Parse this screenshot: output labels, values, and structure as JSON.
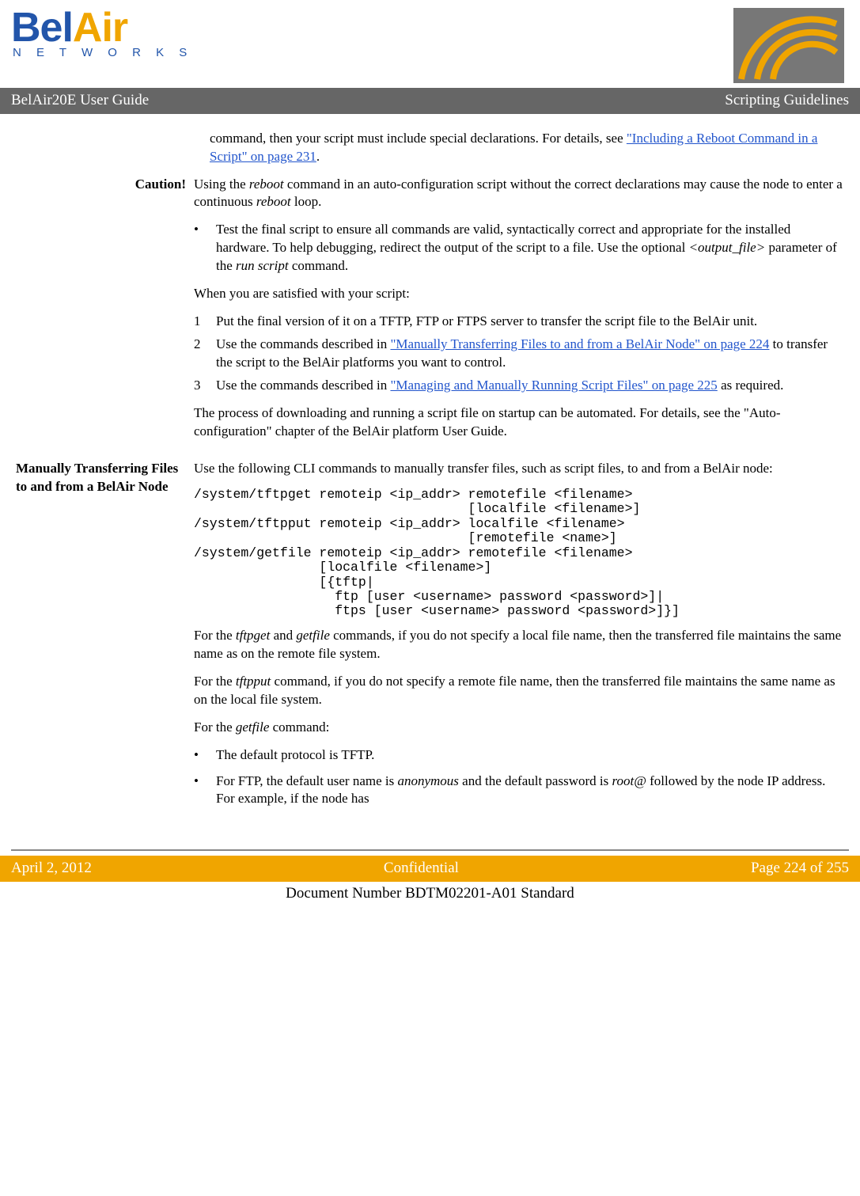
{
  "logo": {
    "brand": "BelAir",
    "sub": "N E T W O R K S"
  },
  "titlebar": {
    "left": "BelAir20E User Guide",
    "right": "Scripting Guidelines"
  },
  "intro": {
    "pre": "command, then your script must include special declarations. For details, see ",
    "link": "\"Including a Reboot Command in a Script\" on page 231",
    "post": "."
  },
  "caution": {
    "label": "Caution!",
    "p1a": "Using the ",
    "p1b": "reboot",
    "p1c": " command in an auto-configuration script without the correct declarations may cause the node to enter a continuous ",
    "p1d": "reboot",
    "p1e": " loop."
  },
  "test_bullet": {
    "a": "Test the final script to ensure all commands are valid, syntactically correct and appropriate for the installed hardware. To help debugging, redirect the output of the script to a file. Use the optional ",
    "b": "<output_file>",
    "c": " parameter of the ",
    "d": "run script",
    "e": " command."
  },
  "satisfied": "When you are satisfied with your script:",
  "steps": {
    "s1": "Put the final version of it on a TFTP, FTP or FTPS server to transfer the script file to the BelAir unit.",
    "s2a": "Use the commands described in ",
    "s2link": "\"Manually Transferring Files to and from a BelAir Node\" on page 224",
    "s2b": " to transfer the script to the BelAir platforms you want to control.",
    "s3a": "Use the commands described in ",
    "s3link": "\"Managing and Manually Running Script Files\" on page 225",
    "s3b": " as required."
  },
  "auto": "The process of downloading and running a script file on startup can be automated. For details, see the \"Auto-configuration\" chapter of the BelAir platform User Guide.",
  "section2": {
    "heading": "Manually Transferring Files to and from a BelAir Node",
    "intro": "Use the following CLI commands to manually transfer files, such as script files, to and from a BelAir node:",
    "code": "/system/tftpget remoteip <ip_addr> remotefile <filename>\n                                   [localfile <filename>]\n/system/tftpput remoteip <ip_addr> localfile <filename>\n                                   [remotefile <name>]\n/system/getfile remoteip <ip_addr> remotefile <filename>\n                [localfile <filename>]\n                [{tftp|\n                  ftp [user <username> password <password>]|\n                  ftps [user <username> password <password>]}]",
    "p2a": "For the ",
    "p2b": "tftpget",
    "p2c": " and ",
    "p2d": "getfile",
    "p2e": " commands, if you do not specify a local file name, then the transferred file maintains the same name as on the remote file system.",
    "p3a": "For the ",
    "p3b": "tftpput",
    "p3c": " command, if you do not specify a remote file name, then the transferred file maintains the same name as on the local file system.",
    "p4a": "For the ",
    "p4b": "getfile",
    "p4c": " command:",
    "b1": "The default protocol is TFTP.",
    "b2a": "For FTP, the default user name is ",
    "b2b": "anonymous",
    "b2c": " and the default password is ",
    "b2d": "root@",
    "b2e": " followed by the node IP address. For example, if the node has"
  },
  "footer": {
    "date": "April 2, 2012",
    "conf": "Confidential",
    "page": "Page 224 of 255",
    "docnum": "Document Number BDTM02201-A01 Standard"
  }
}
